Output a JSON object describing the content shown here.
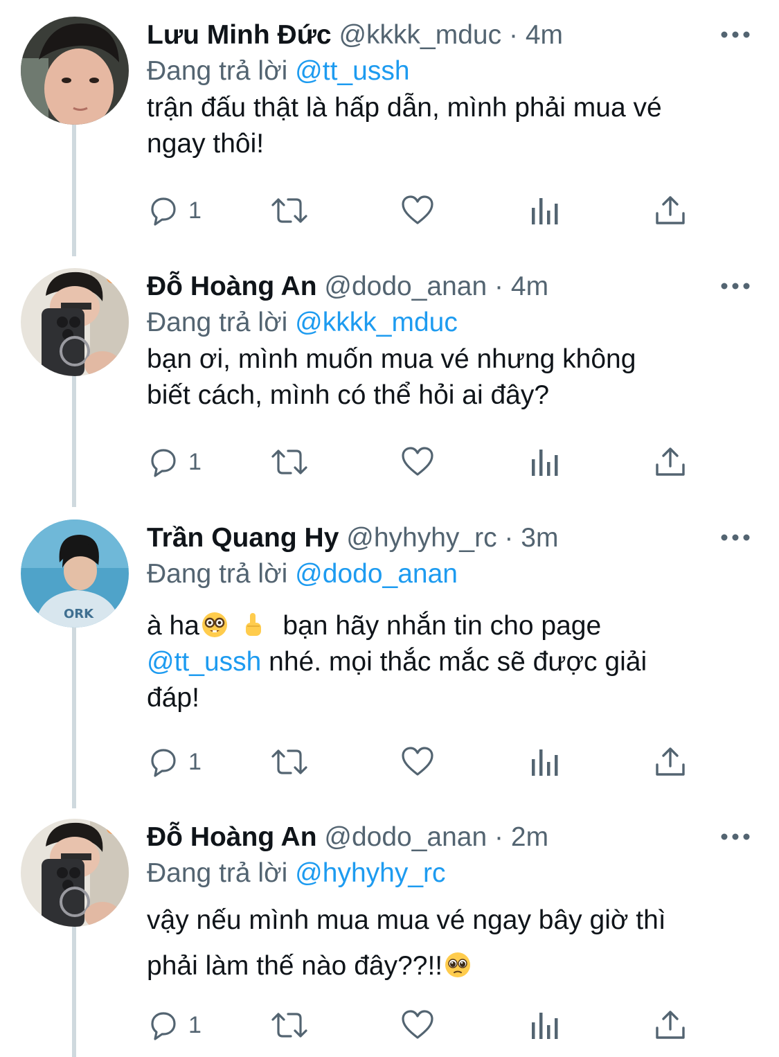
{
  "tweets": [
    {
      "name": "Lưu Minh Đức",
      "handle": "@kkkk_mduc",
      "separator": "·",
      "time": "4m",
      "replying_prefix": "Đang trả lời",
      "replying_to": "@tt_ussh",
      "text_line1": "trận đấu thật là hấp dẫn, mình phải mua vé",
      "text_line2": "ngay thôi!",
      "reply_count": "1"
    },
    {
      "name": "Đỗ Hoàng An",
      "handle": "@dodo_anan",
      "separator": "·",
      "time": "4m",
      "replying_prefix": "Đang trả lời",
      "replying_to": "@kkkk_mduc",
      "text_line1": "bạn ơi, mình muốn mua vé nhưng không",
      "text_line2": "biết cách, mình có thể hỏi ai đây?",
      "reply_count": "1"
    },
    {
      "name": "Trần Quang Hy",
      "handle": "@hyhyhy_rc",
      "separator": "·",
      "time": "3m",
      "replying_prefix": "Đang trả lời",
      "replying_to": "@dodo_anan",
      "text_part1": "à ha",
      "text_part2": "bạn hãy nhắn tin cho page",
      "text_mention": "@tt_ussh",
      "text_part3": " nhé. mọi thắc mắc sẽ được giải",
      "text_part4": "đáp!",
      "reply_count": "1"
    },
    {
      "name": "Đỗ Hoàng An",
      "handle": "@dodo_anan",
      "separator": "·",
      "time": "2m",
      "replying_prefix": "Đang trả lời",
      "replying_to": "@hyhyhy_rc",
      "text_line1": "vậy nếu mình mua mua vé ngay bây giờ thì",
      "text_line2": "phải làm thế nào đây??!!",
      "reply_count": "1"
    }
  ],
  "icons": {
    "more": "more-horizontal-icon",
    "reply": "reply-icon",
    "retweet": "retweet-icon",
    "like": "heart-icon",
    "views": "views-icon",
    "share": "share-icon"
  },
  "colors": {
    "text": "#0f1419",
    "secondary": "#536471",
    "accent": "#1d9bf0",
    "thread_line": "#cfd9de"
  }
}
